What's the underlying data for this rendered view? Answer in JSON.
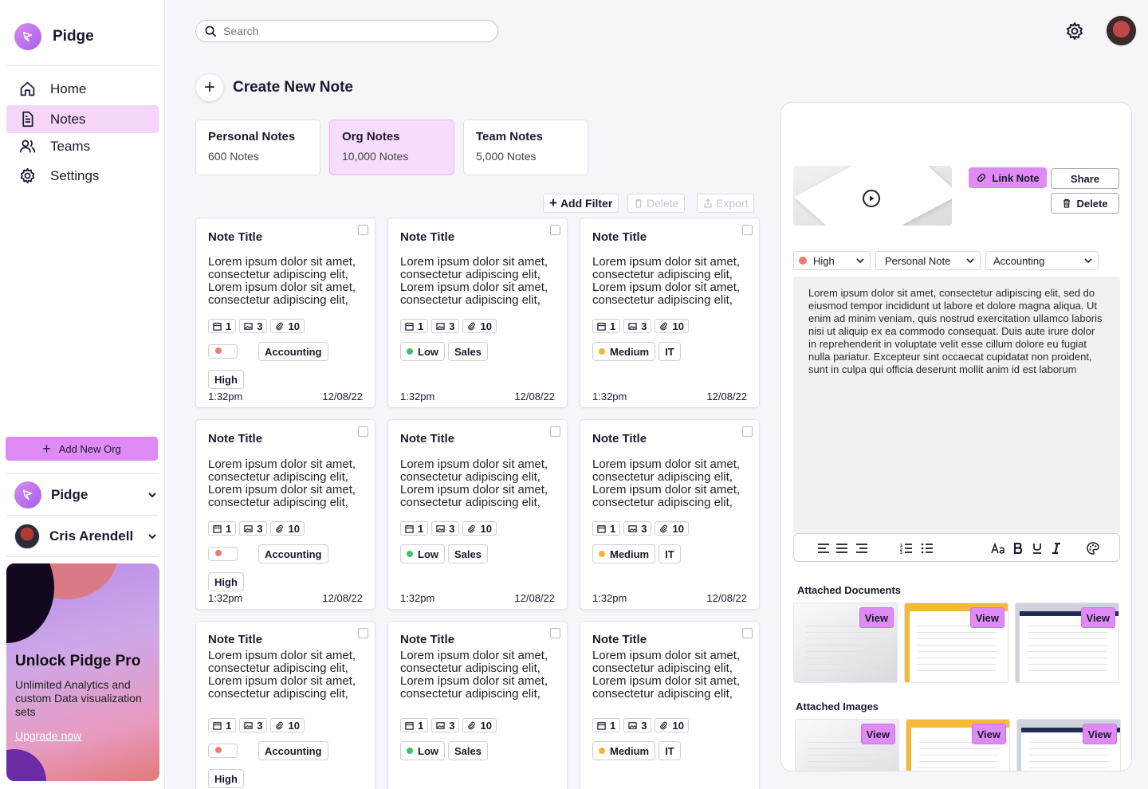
{
  "sidebar": {
    "brand": "Pidge",
    "nav": [
      {
        "label": "Home",
        "icon": "home-icon"
      },
      {
        "label": "Notes",
        "icon": "document-icon"
      },
      {
        "label": "Teams",
        "icon": "users-icon"
      },
      {
        "label": "Settings",
        "icon": "gear-icon"
      }
    ],
    "add_org_label": "Add New Org",
    "org_name": "Pidge",
    "user_name": "Cris Arendell",
    "promo": {
      "title": "Unlock Pidge Pro",
      "text": "Unlimited Analytics and custom Data visualization sets",
      "link": "Upgrade now"
    }
  },
  "header": {
    "search_placeholder": "Search"
  },
  "main": {
    "create_label": "Create New Note",
    "tabs": [
      {
        "title": "Personal Notes",
        "count": "600 Notes"
      },
      {
        "title": "Org Notes",
        "count": "10,000 Notes"
      },
      {
        "title": "Team Notes",
        "count": "5,000 Notes"
      }
    ],
    "toolbar": {
      "add_filter": "Add Filter",
      "delete": "Delete",
      "export": "Export"
    },
    "cards": [
      {
        "title": "Note Title",
        "body": "Lorem ipsum dolor sit amet, consectetur adipiscing elit, Lorem ipsum dolor sit amet, consectetur adipiscing elit,",
        "meta": [
          "1",
          "3",
          "10"
        ],
        "priority": "High",
        "tag": "Accounting",
        "time": "1:32pm",
        "date": "12/08/22"
      },
      {
        "title": "Note Title",
        "body": "Lorem ipsum dolor sit amet, consectetur adipiscing elit, Lorem ipsum dolor sit amet, consectetur adipiscing elit,",
        "meta": [
          "1",
          "3",
          "10"
        ],
        "priority": "Low",
        "tag": "Sales",
        "time": "1:32pm",
        "date": "12/08/22"
      },
      {
        "title": "Note Title",
        "body": "Lorem ipsum dolor sit amet, consectetur adipiscing elit, Lorem ipsum dolor sit amet, consectetur adipiscing elit,",
        "meta": [
          "1",
          "3",
          "10"
        ],
        "priority": "Medium",
        "tag": "IT",
        "time": "1:32pm",
        "date": "12/08/22"
      },
      {
        "title": "Note Title",
        "body": "Lorem ipsum dolor sit amet, consectetur adipiscing elit, Lorem ipsum dolor sit amet, consectetur adipiscing elit,",
        "meta": [
          "1",
          "3",
          "10"
        ],
        "priority": "High",
        "tag": "Accounting",
        "time": "1:32pm",
        "date": "12/08/22"
      },
      {
        "title": "Note Title",
        "body": "Lorem ipsum dolor sit amet, consectetur adipiscing elit, Lorem ipsum dolor sit amet, consectetur adipiscing elit,",
        "meta": [
          "1",
          "3",
          "10"
        ],
        "priority": "Low",
        "tag": "Sales",
        "time": "1:32pm",
        "date": "12/08/22"
      },
      {
        "title": "Note Title",
        "body": "Lorem ipsum dolor sit amet, consectetur adipiscing elit, Lorem ipsum dolor sit amet, consectetur adipiscing elit,",
        "meta": [
          "1",
          "3",
          "10"
        ],
        "priority": "Medium",
        "tag": "IT",
        "time": "1:32pm",
        "date": "12/08/22"
      },
      {
        "title": "Note Title",
        "body": "Lorem ipsum dolor sit amet, consectetur adipiscing elit, Lorem ipsum dolor sit amet, consectetur adipiscing elit,",
        "meta": [
          "1",
          "3",
          "10"
        ],
        "priority": "High",
        "tag": "Accounting",
        "time": "",
        "date": ""
      },
      {
        "title": "Note Title",
        "body": "Lorem ipsum dolor sit amet, consectetur adipiscing elit, Lorem ipsum dolor sit amet, consectetur adipiscing elit,",
        "meta": [
          "1",
          "3",
          "10"
        ],
        "priority": "Low",
        "tag": "Sales",
        "time": "",
        "date": ""
      },
      {
        "title": "Note Title",
        "body": "Lorem ipsum dolor sit amet, consectetur adipiscing elit, Lorem ipsum dolor sit amet, consectetur adipiscing elit,",
        "meta": [
          "1",
          "3",
          "10"
        ],
        "priority": "Medium",
        "tag": "IT",
        "time": "",
        "date": ""
      }
    ]
  },
  "panel": {
    "link_note": "Link Note",
    "share": "Share",
    "delete": "Delete",
    "priority": "High",
    "note_type": "Personal Note",
    "category": "Accounting",
    "body": "Lorem ipsum dolor sit amet, consectetur adipiscing elit, sed do eiusmod tempor incididunt ut labore et dolore magna aliqua. Ut enim ad minim veniam, quis nostrud exercitation ullamco laboris nisi ut aliquip ex ea commodo consequat. Duis aute irure dolor in reprehenderit in voluptate velit esse cillum dolore eu fugiat nulla pariatur. Excepteur sint occaecat cupidatat non proident, sunt in culpa qui officia deserunt mollit anim id est laborum",
    "attached_documents_title": "Attached Documents",
    "attached_images_title": "Attached Images",
    "view_label": "View"
  },
  "colors": {
    "accent": "#e08bf5",
    "high": "#f07a6e",
    "low": "#3cc46a",
    "medium": "#f2b632"
  }
}
